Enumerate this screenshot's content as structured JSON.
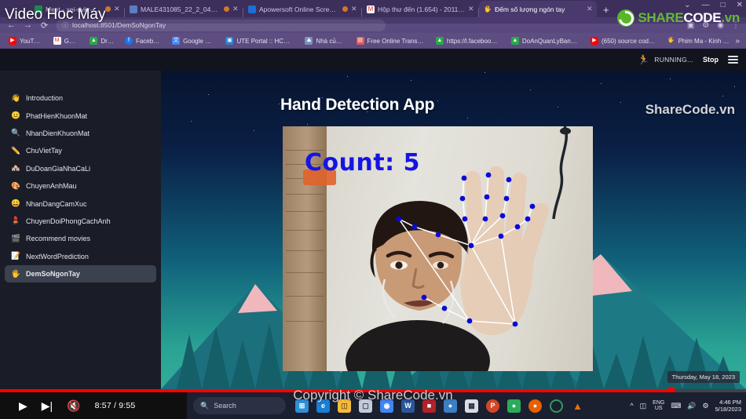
{
  "browser": {
    "tabs": [
      {
        "title": "Meet - xei-dvkr-bgk",
        "favicon": "meet-icon",
        "color": "#1a8a4b",
        "active": false,
        "recording": true
      },
      {
        "title": "MALE431085_22_2_04CLC: Nộp ...",
        "favicon": "doc-icon",
        "color": "#5a7fbf",
        "active": false,
        "recording": true
      },
      {
        "title": "Apowersoft Online Screen R...",
        "favicon": "apowersoft-icon",
        "color": "#1b6fd6",
        "active": false,
        "recording": true
      },
      {
        "title": "Hộp thư đến (1.654) - 20110590...",
        "favicon": "gmail-icon",
        "color": "#d93025",
        "active": false,
        "recording": false
      },
      {
        "title": "Đếm số lượng ngón tay",
        "favicon": "hand-icon",
        "color": "#f5b44b",
        "active": true,
        "recording": false
      }
    ],
    "new_tab_label": "+",
    "window_controls": {
      "minimize": "—",
      "maximize": "□",
      "close": "✕",
      "chevron": "⌄"
    },
    "nav": {
      "back": "←",
      "forward": "→",
      "reload": "⟳"
    },
    "url": "localhost:8501/DemSoNgonTay",
    "url_icon": "info-circle-icon",
    "bookmarks": [
      {
        "label": "YouTube",
        "icon": "youtube-icon",
        "color": "#ff0000"
      },
      {
        "label": "Gmail",
        "icon": "gmail-icon",
        "color": "#ffffff"
      },
      {
        "label": "Drive",
        "icon": "drive-icon",
        "color": "#ffffff"
      },
      {
        "label": "Facebook",
        "icon": "facebook-icon",
        "color": "#1877f2"
      },
      {
        "label": "Google Dịch",
        "icon": "translate-icon",
        "color": "#4285f4"
      },
      {
        "label": "UTE Portal :: HCMC...",
        "icon": "portal-icon",
        "color": "#2a7fd4"
      },
      {
        "label": "Nhà của tôi",
        "icon": "home-icon",
        "color": "#7b93b8"
      },
      {
        "label": "Free Online Translat...",
        "icon": "translate2-icon",
        "color": "#e05a5a"
      },
      {
        "label": "https://l.facebook.c...",
        "icon": "drive-icon",
        "color": "#ffffff"
      },
      {
        "label": "DoAnQuanLyBanHa...",
        "icon": "drive-icon",
        "color": "#ffffff"
      },
      {
        "label": "(650) source code j...",
        "icon": "youtube-icon",
        "color": "#ff0000"
      },
      {
        "label": "Phim Ma - Kinh Dị...",
        "icon": "hand-icon",
        "color": "#f5b44b"
      }
    ],
    "bookmarks_overflow": "»"
  },
  "streamlit": {
    "header": {
      "running_icon": "running-man-icon",
      "running_text": "RUNNING...",
      "stop_label": "Stop",
      "menu_icon": "hamburger-menu-icon"
    },
    "sidebar": {
      "close_icon": "✕",
      "items": [
        {
          "emoji": "👋",
          "label": "Introduction",
          "active": false
        },
        {
          "emoji": "😐",
          "label": "PhatHienKhuonMat",
          "active": false
        },
        {
          "emoji": "🔍",
          "label": "NhanDienKhuonMat",
          "active": false
        },
        {
          "emoji": "✏️",
          "label": "ChuVietTay",
          "active": false
        },
        {
          "emoji": "🏘️",
          "label": "DuDoanGiaNhaCaLi",
          "active": false
        },
        {
          "emoji": "🎨",
          "label": "ChuyenAnhMau",
          "active": false
        },
        {
          "emoji": "😀",
          "label": "NhanDangCamXuc",
          "active": false
        },
        {
          "emoji": "💄",
          "label": "ChuyenDoiPhongCachAnh",
          "active": false
        },
        {
          "emoji": "🎬",
          "label": "Recommend movies",
          "active": false
        },
        {
          "emoji": "📝",
          "label": "NextWordPrediction",
          "active": false
        },
        {
          "emoji": "🖐️",
          "label": "DemSoNgonTay",
          "active": true
        }
      ]
    },
    "main": {
      "title": "Hand Detection App",
      "video_overlay_count": "Count:  5",
      "count_value": 5,
      "count_color": "#1414e6",
      "watermark": "ShareCode.vn",
      "date_badge": "Thursday, May 18, 2023"
    }
  },
  "youtube": {
    "play_icon": "play-icon",
    "next_icon": "next-track-icon",
    "mute_icon": "muted-volume-icon",
    "time": "8:57 / 9:55",
    "current_time": "8:57",
    "duration": "9:55",
    "progress_percent": 90
  },
  "taskbar": {
    "search_icon": "search-icon",
    "search_placeholder": "Search",
    "icons": [
      {
        "name": "start-icon",
        "glyph": "⊞",
        "color": "#2f8fd8"
      },
      {
        "name": "edge-icon",
        "glyph": "e",
        "color": "#1a7fd4"
      },
      {
        "name": "file-explorer-icon",
        "glyph": "🗂",
        "color": "#f5bb3c"
      },
      {
        "name": "store-icon",
        "glyph": "🛍",
        "color": "#c3cbd8"
      },
      {
        "name": "chrome-icon",
        "glyph": "◉",
        "color": "#4285f4"
      },
      {
        "name": "word-icon",
        "glyph": "W",
        "color": "#2b579a"
      },
      {
        "name": "book-icon",
        "glyph": "📕",
        "color": "#b0232a"
      },
      {
        "name": "app-blue-icon",
        "glyph": "●",
        "color": "#3b7fc4"
      },
      {
        "name": "qr-icon",
        "glyph": "▦",
        "color": "#d8dde5"
      },
      {
        "name": "powerpoint-icon",
        "glyph": "P",
        "color": "#d24726"
      },
      {
        "name": "app-green-icon",
        "glyph": "●",
        "color": "#2bab5a"
      },
      {
        "name": "firefox-icon",
        "glyph": "●",
        "color": "#e66000"
      },
      {
        "name": "ring-icon",
        "glyph": "◯",
        "color": "#2e9a5e"
      },
      {
        "name": "vlc-icon",
        "glyph": "▲",
        "color": "#e8700a"
      }
    ],
    "tray": {
      "chevron": "^",
      "battery_icon": "battery-icon",
      "lang_top": "ENG",
      "lang_bottom": "US",
      "keyboard_icon": "keyboard-icon",
      "volume_icon": "volume-icon",
      "settings_icon": "gear-icon",
      "time": "4:46 PM",
      "date": "5/18/2023"
    }
  },
  "overlays": {
    "video_title": "Video Hoc Máy",
    "logo": {
      "share": "SHARE",
      "code": "CODE",
      "tld": ".vn",
      "mark": "sharecode-logo-icon"
    },
    "copyright": "Copyright © ShareCode.vn"
  }
}
